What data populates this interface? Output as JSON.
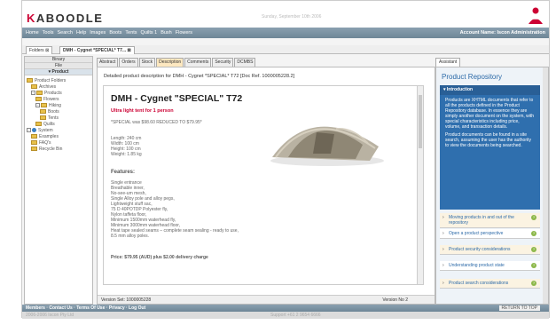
{
  "header": {
    "logo_a": "K",
    "logo_b": "ABOODLE",
    "date": "Sunday, September 10th 2006"
  },
  "nav": {
    "items": [
      "Home",
      "Tools",
      "Search",
      "Help",
      "Images",
      "Boots",
      "Tents",
      "Quilts 1",
      "Bush",
      "Flowers"
    ],
    "account": "Account Name: Iscon Administration"
  },
  "breadcrumb": {
    "folders": "Folders",
    "doc_tab": "DMH - Cygnet *SPECIAL* T7..."
  },
  "left": {
    "sections": [
      "Binary",
      "File",
      "Product"
    ],
    "tree": [
      {
        "label": "Product Folders",
        "type": "folder"
      },
      {
        "label": "Archives",
        "type": "folder"
      },
      {
        "label": "Products",
        "type": "folder"
      },
      {
        "label": "Flowers",
        "type": "folder"
      },
      {
        "label": "Hiking",
        "type": "folder"
      },
      {
        "label": "Boots",
        "type": "folder"
      },
      {
        "label": "Tents",
        "type": "folder"
      },
      {
        "label": "Quilts",
        "type": "folder"
      },
      {
        "label": "System",
        "type": "page"
      },
      {
        "label": "Examples",
        "type": "folder"
      },
      {
        "label": "FAQ's",
        "type": "folder"
      },
      {
        "label": "Recycle Bin",
        "type": "folder"
      }
    ]
  },
  "center": {
    "tabs": [
      "Abstract",
      "Orders",
      "Stock",
      "Description",
      "Comments",
      "Security",
      "DCMBS"
    ],
    "active_tab": "Description",
    "desc": "Detailed product description for DMH - Cygnet *SPECIAL* T72 [Doc Ref. 1000005228.2]",
    "title": "DMH - Cygnet \"SPECIAL\" T72",
    "subtitle": "Ultra light tent for 1 person",
    "special": "*SPECIAL was $98.60 REDUCED TO $79.95*",
    "dims": "Length: 240 cm\nWidth: 100 cm\nHeight: 100 cm\nWeight: 1.85 kg",
    "features_head": "Features:",
    "features": "Single entrance\nBreathable inner,\nNo-see-um mesh,\nSingle Alloy pole and alloy pegs,\nLightweight stuff sac,\n75 D 40POTDP Polyester fly,\nNylon taffeta floor,\nMinimum 1500mm waterhead fly,\nMinimum 3000mm waterhead floor,\nHeat tape sealed seams – complete seam sealing - ready to use,\n8.5 mm alloy poles.",
    "price": "Price: $79.95 (AUD) plus $2.00 delivery charge",
    "version_set": "Version Set: 1000005228",
    "version_no": "Version No 2"
  },
  "right": {
    "tab": "Assistant",
    "title": "Product Repository",
    "intro_head": "Introduction",
    "intro_text": "Products are XHTML documents that refer to all the products defined in the Product Repository database. In essence they are simply another document on the system, with special characteristics including price, volume, and transaction details.",
    "intro_text2": "Product documents can be found in a site search, assuming the user has the authority to view the documents being searched.",
    "items": [
      "Moving products in and out of the repository",
      "Open a product perspective",
      "Product security considerations",
      "Understanding product state",
      "Product search considerations"
    ]
  },
  "footer": {
    "links": "Members · Contact Us · Terms Of Use · Privacy · Log Out",
    "copy": "2006-2006 Iscon Pty Ltd",
    "support": "Support +61 2 9654 6666",
    "top": "RETURN TO TOP"
  },
  "colors": {
    "accent": "#c03",
    "brand_blue": "#2f6fae",
    "nav": "#7c93a3"
  }
}
